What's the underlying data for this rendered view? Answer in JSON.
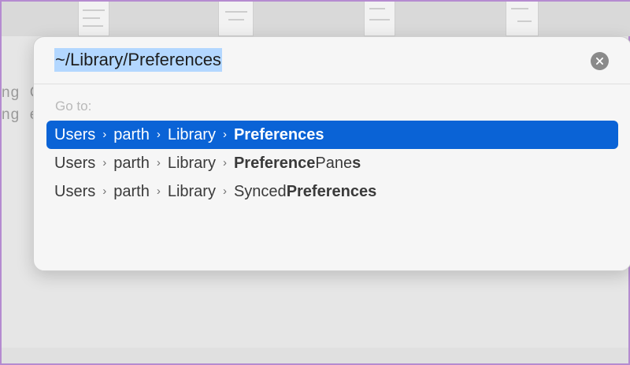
{
  "background": {
    "text_line_1": "ng  C",
    "text_line_2": "ng  e"
  },
  "dialog": {
    "path_value": "~/Library/Preferences",
    "clear_icon": "clear-x-icon",
    "goto_label": "Go to:",
    "results": [
      {
        "parts": [
          {
            "pre": "Users",
            "bold": "",
            "post": ""
          },
          {
            "pre": "parth",
            "bold": "",
            "post": ""
          },
          {
            "pre": "Library",
            "bold": "",
            "post": ""
          },
          {
            "pre": "",
            "bold": "Preferences",
            "post": ""
          }
        ],
        "selected": true
      },
      {
        "parts": [
          {
            "pre": "Users",
            "bold": "",
            "post": ""
          },
          {
            "pre": "parth",
            "bold": "",
            "post": ""
          },
          {
            "pre": "Library",
            "bold": "",
            "post": ""
          },
          {
            "pre": "",
            "bold": "Preference",
            "post": "Pane",
            "tail_bold": "s"
          }
        ],
        "selected": false
      },
      {
        "parts": [
          {
            "pre": "Users",
            "bold": "",
            "post": ""
          },
          {
            "pre": "parth",
            "bold": "",
            "post": ""
          },
          {
            "pre": "Library",
            "bold": "",
            "post": ""
          },
          {
            "pre": "Synced",
            "bold": "Preferences",
            "post": ""
          }
        ],
        "selected": false
      }
    ],
    "colors": {
      "selection": "#0a63d6",
      "text_highlight": "#b3d7ff"
    }
  }
}
